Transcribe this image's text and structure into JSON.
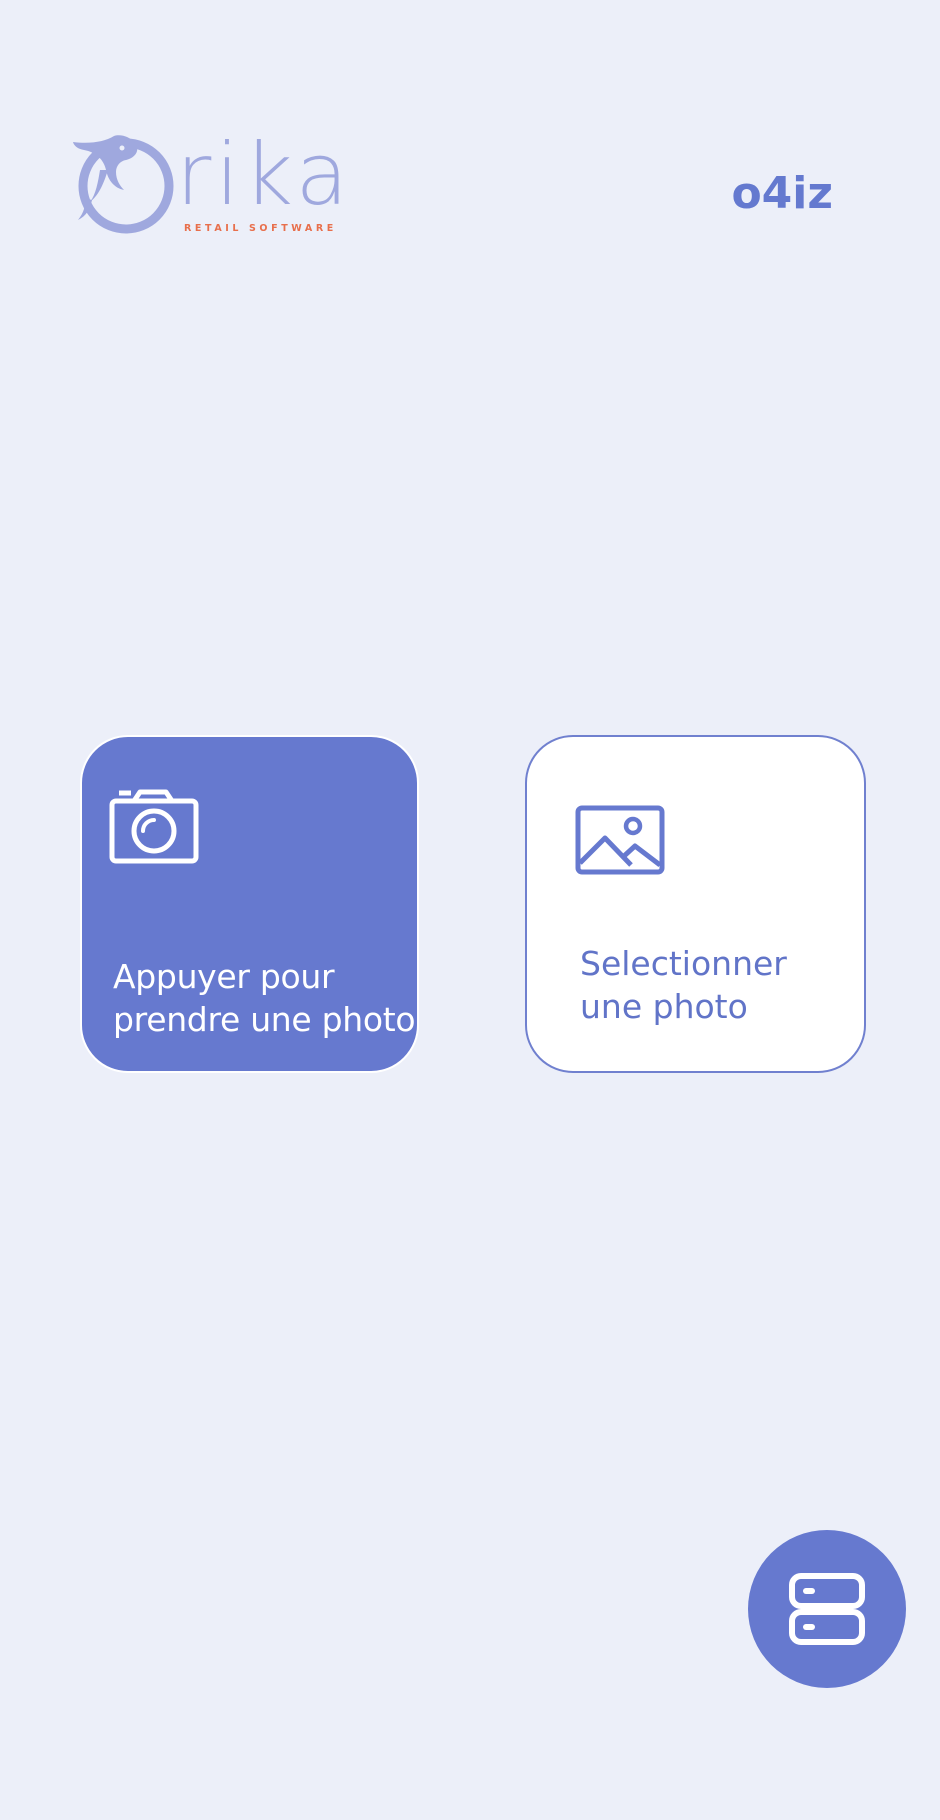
{
  "header": {
    "logo_wordmark": "rika",
    "logo_tagline": "RETAIL SOFTWARE",
    "user_code": "o4iz"
  },
  "actions": {
    "take_photo": {
      "icon": "camera-icon",
      "label_line1": "Appuyer pour",
      "label_line2": "prendre une photo"
    },
    "select_photo": {
      "icon": "image-icon",
      "label_line1": "Selectionner",
      "label_line2": "une photo"
    }
  },
  "fab": {
    "icon": "server-icon"
  },
  "colors": {
    "background": "#eceff9",
    "accent": "#6679cf",
    "logo": "#9fa8de",
    "logo_tagline": "#e86f4c",
    "card_light": "#ffffff"
  }
}
